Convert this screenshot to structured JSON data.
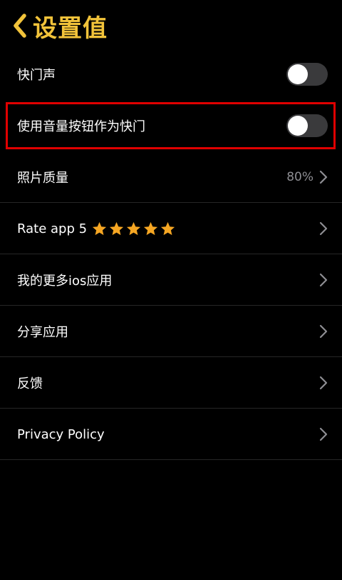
{
  "header": {
    "title": "设置值",
    "back_icon": "chevron-left-icon"
  },
  "colors": {
    "background": "#000000",
    "accent": "#f2c33a",
    "highlight": "#e00000",
    "toggle_off": "#3a3a3c",
    "secondary_text": "#8e8e93",
    "star": "#f5a623"
  },
  "settings": {
    "shutter_sound": {
      "label": "快门声",
      "enabled": false
    },
    "volume_shutter": {
      "label": "使用音量按钮作为快门",
      "enabled": false
    },
    "photo_quality": {
      "label": "照片质量",
      "value": "80%"
    },
    "rate_app": {
      "label": "Rate app 5",
      "stars": 5
    },
    "more_apps": {
      "label": "我的更多ios应用"
    },
    "share_app": {
      "label": "分享应用"
    },
    "feedback": {
      "label": "反馈"
    },
    "privacy_policy": {
      "label": "Privacy Policy"
    }
  }
}
